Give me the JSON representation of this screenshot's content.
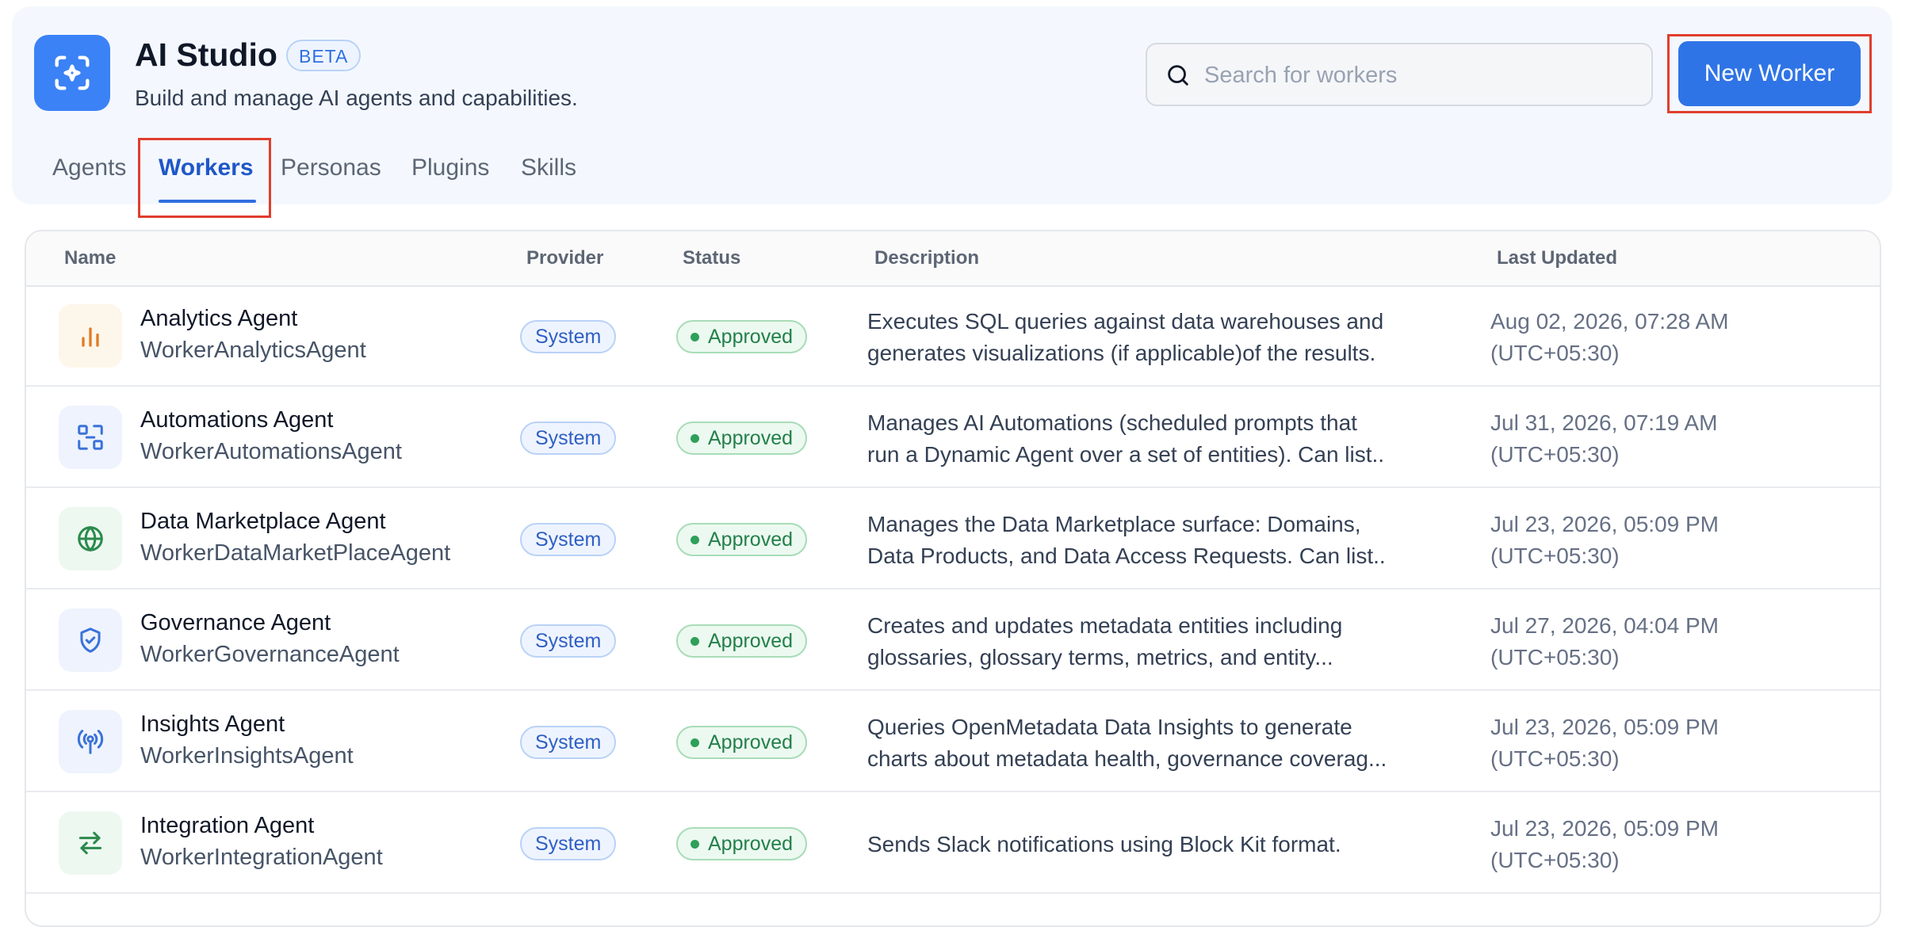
{
  "app": {
    "title": "AI Studio",
    "badge": "BETA",
    "subtitle": "Build and manage AI agents and capabilities."
  },
  "search": {
    "placeholder": "Search for workers",
    "value": ""
  },
  "actions": {
    "new_worker_label": "New Worker"
  },
  "tabs": [
    {
      "label": "Agents",
      "active": false
    },
    {
      "label": "Workers",
      "active": true
    },
    {
      "label": "Personas",
      "active": false
    },
    {
      "label": "Plugins",
      "active": false
    },
    {
      "label": "Skills",
      "active": false
    }
  ],
  "table": {
    "columns": [
      "Name",
      "Provider",
      "Status",
      "Description",
      "Last Updated"
    ],
    "rows": [
      {
        "name": "Analytics Agent",
        "id": "WorkerAnalyticsAgent",
        "icon": "bar-chart-icon",
        "provider": "System",
        "status": "Approved",
        "description_line1": "Executes SQL queries against data warehouses and",
        "description_line2": "generates visualizations (if applicable)of the results.",
        "date": "Aug 02, 2026, 07:28 AM",
        "timezone": "(UTC+05:30)"
      },
      {
        "name": "Automations Agent",
        "id": "WorkerAutomationsAgent",
        "icon": "automation-icon",
        "provider": "System",
        "status": "Approved",
        "description_line1": "Manages AI Automations (scheduled prompts that",
        "description_line2": "run a Dynamic Agent over a set of entities). Can list..",
        "date": "Jul 31, 2026, 07:19 AM",
        "timezone": "(UTC+05:30)"
      },
      {
        "name": "Data Marketplace Agent",
        "id": "WorkerDataMarketPlaceAgent",
        "icon": "globe-icon",
        "provider": "System",
        "status": "Approved",
        "description_line1": "Manages the Data Marketplace surface: Domains,",
        "description_line2": "Data Products, and Data Access Requests. Can list..",
        "date": "Jul 23, 2026, 05:09 PM",
        "timezone": "(UTC+05:30)"
      },
      {
        "name": "Governance Agent",
        "id": "WorkerGovernanceAgent",
        "icon": "shield-check-icon",
        "provider": "System",
        "status": "Approved",
        "description_line1": "Creates and updates metadata entities including",
        "description_line2": "glossaries, glossary terms, metrics, and entity...",
        "date": "Jul 27, 2026, 04:04 PM",
        "timezone": "(UTC+05:30)"
      },
      {
        "name": "Insights Agent",
        "id": "WorkerInsightsAgent",
        "icon": "broadcast-icon",
        "provider": "System",
        "status": "Approved",
        "description_line1": "Queries OpenMetadata Data Insights to generate",
        "description_line2": "charts about metadata health, governance coverag...",
        "date": "Jul 23, 2026, 05:09 PM",
        "timezone": "(UTC+05:30)"
      },
      {
        "name": "Integration Agent",
        "id": "WorkerIntegrationAgent",
        "icon": "swap-arrows-icon",
        "provider": "System",
        "status": "Approved",
        "description_line1": "Sends Slack notifications using Block Kit format.",
        "description_line2": "",
        "date": "Jul 23, 2026, 05:09 PM",
        "timezone": "(UTC+05:30)"
      }
    ]
  },
  "colors": {
    "accent": "#2f74e6",
    "highlight": "#e03e2d",
    "approved": "#22804a"
  }
}
